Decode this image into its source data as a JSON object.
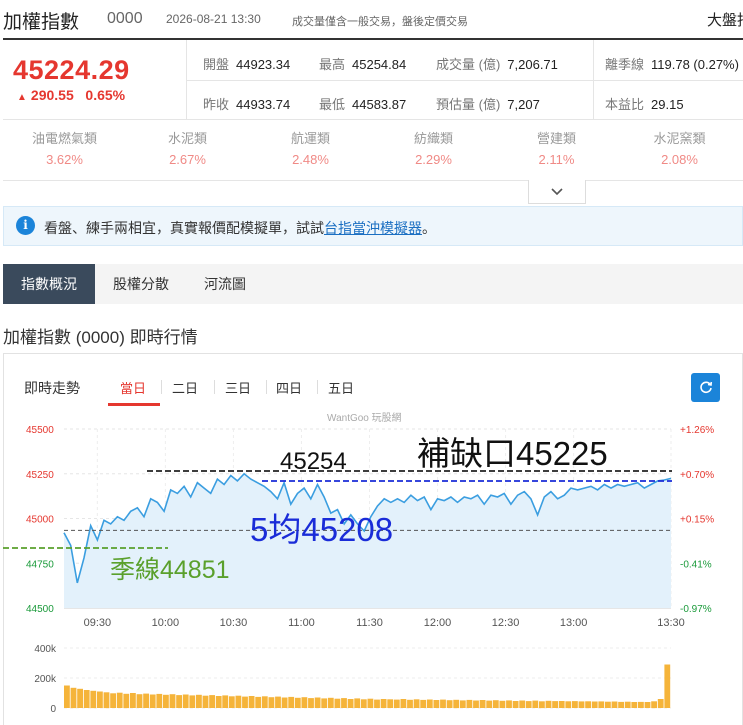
{
  "header": {
    "title": "加權指數",
    "code": "0000",
    "datetime": "2026-08-21 13:30",
    "note": "成交量僅含一般交易，盤後定價交易",
    "right_label": "大盤指"
  },
  "quote": {
    "price": "45224.29",
    "arrow": "▲",
    "change": "290.55",
    "change_pct": "0.65%",
    "stats": {
      "open_label": "開盤",
      "open": "44923.34",
      "high_label": "最高",
      "high": "45254.84",
      "volume_label": "成交量 (億)",
      "volume": "7,206.71",
      "spread_label": "離季線",
      "spread": "119.78 (0.27%)",
      "prev_label": "昨收",
      "prev": "44933.74",
      "low_label": "最低",
      "low": "44583.87",
      "est_label": "預估量 (億)",
      "est": "7,207",
      "pe_label": "本益比",
      "pe": "29.15"
    }
  },
  "sectors": [
    {
      "name": "油電燃氣類",
      "pct": "3.62%"
    },
    {
      "name": "水泥類",
      "pct": "2.67%"
    },
    {
      "name": "航運類",
      "pct": "2.48%"
    },
    {
      "name": "紡織類",
      "pct": "2.29%"
    },
    {
      "name": "營建類",
      "pct": "2.11%"
    },
    {
      "name": "水泥窯類",
      "pct": "2.08%"
    }
  ],
  "expand_icon": "chevron-down-icon",
  "info": {
    "icon": "i",
    "text": "看盤、練手兩相宜，真實報價配模擬單，試試",
    "link": "台指當沖模擬器",
    "suffix": "。"
  },
  "tabs": [
    "指數概況",
    "股權分散",
    "河流圖"
  ],
  "section_title": "加權指數 (0000) 即時行情",
  "chart_panel": {
    "label": "即時走勢",
    "ranges": [
      "當日",
      "二日",
      "三日",
      "四日",
      "五日"
    ],
    "active_range": "當日",
    "refresh_icon": "refresh-icon",
    "watermark": "WantGoo 玩股網"
  },
  "colors": {
    "accent_red": "#e5372f",
    "line_blue": "#3b9ee0",
    "fill_blue": "#e3f1fb",
    "annotation_blue": "#1a2cd8",
    "annotation_green": "#5aa02c",
    "volume_orange": "#f5b43a"
  },
  "chart_data": {
    "type": "line",
    "x_ticks": [
      "09:30",
      "10:00",
      "10:30",
      "11:00",
      "11:30",
      "12:00",
      "12:30",
      "13:00",
      "13:30"
    ],
    "y_ticks_left": [
      "45500",
      "45250",
      "45000",
      "44750",
      "44500"
    ],
    "y_ticks_right": [
      "+1.26%",
      "+0.70%",
      "+0.15%",
      "-0.41%",
      "-0.97%"
    ],
    "ylim": [
      44500,
      45500
    ],
    "reference": 44933.74,
    "series": [
      {
        "x": [
          0,
          3,
          6,
          9,
          12,
          15,
          18,
          21,
          24,
          27,
          30,
          33,
          36,
          39,
          42,
          45,
          48,
          51,
          54,
          57,
          60,
          63,
          66,
          69,
          72,
          75,
          78,
          81,
          84,
          87,
          90,
          93,
          96,
          99,
          102,
          105,
          108,
          111,
          114,
          117,
          120,
          123,
          126,
          129,
          132,
          135,
          138,
          141,
          144,
          147,
          150,
          153,
          156,
          159,
          162,
          165,
          168,
          171,
          174,
          177,
          180,
          183,
          186,
          189,
          192,
          195,
          198,
          201,
          204,
          207,
          210,
          213,
          216,
          219,
          222,
          225,
          228,
          231,
          234,
          237,
          240,
          243,
          246,
          249,
          252,
          255,
          258,
          261,
          264,
          267,
          270,
          273
        ],
        "values": [
          44920,
          44850,
          44640,
          44780,
          44960,
          44880,
          44990,
          44970,
          45010,
          44990,
          45040,
          45060,
          45010,
          45110,
          45090,
          45040,
          45160,
          45140,
          45180,
          45120,
          45200,
          45170,
          45140,
          45220,
          45190,
          45240,
          45210,
          45250,
          45220,
          45200,
          45180,
          45150,
          45110,
          45200,
          45080,
          45140,
          45170,
          45110,
          45190,
          45120,
          45030,
          45050,
          44970,
          45020,
          44970,
          44930,
          45010,
          45070,
          45110,
          45090,
          45110,
          45090,
          45130,
          45100,
          45120,
          45050,
          45110,
          45100,
          45120,
          45090,
          45120,
          45110,
          45130,
          45080,
          45130,
          45120,
          45140,
          45080,
          45130,
          45150,
          45110,
          45020,
          45120,
          45150,
          45110,
          45130,
          45170,
          45160,
          45170,
          45180,
          45160,
          45190,
          45170,
          45190,
          45180,
          45190,
          45200,
          45170,
          45190,
          45210,
          45215,
          45224
        ]
      }
    ],
    "volume_ticks": [
      "400k",
      "200k",
      "0"
    ],
    "volume_ylim": [
      0,
      400000
    ],
    "volume": [
      150000,
      135000,
      128000,
      120000,
      115000,
      110000,
      105000,
      98000,
      102000,
      95000,
      100000,
      92000,
      96000,
      90000,
      94000,
      88000,
      92000,
      86000,
      90000,
      84000,
      88000,
      82000,
      86000,
      80000,
      84000,
      78000,
      82000,
      76000,
      80000,
      74000,
      78000,
      72000,
      76000,
      70000,
      74000,
      68000,
      72000,
      66000,
      70000,
      64000,
      68000,
      62000,
      66000,
      60000,
      64000,
      58000,
      62000,
      56000,
      60000,
      58000,
      56000,
      60000,
      55000,
      58000,
      54000,
      57000,
      53000,
      56000,
      52000,
      55000,
      51000,
      54000,
      50000,
      53000,
      49000,
      52000,
      48000,
      51000,
      47000,
      50000,
      46000,
      49000,
      45000,
      48000,
      46000,
      47000,
      45000,
      46000,
      44000,
      45000,
      43000,
      44000,
      42000,
      43000,
      41000,
      42000,
      40000,
      41000,
      40000,
      45000,
      60000,
      290000
    ],
    "annotations": {
      "high_value": "45254",
      "gap_fill": "補缺口45225",
      "ma5": "5均45208",
      "quarter_line": "季線44851"
    },
    "grid": "dashed"
  }
}
